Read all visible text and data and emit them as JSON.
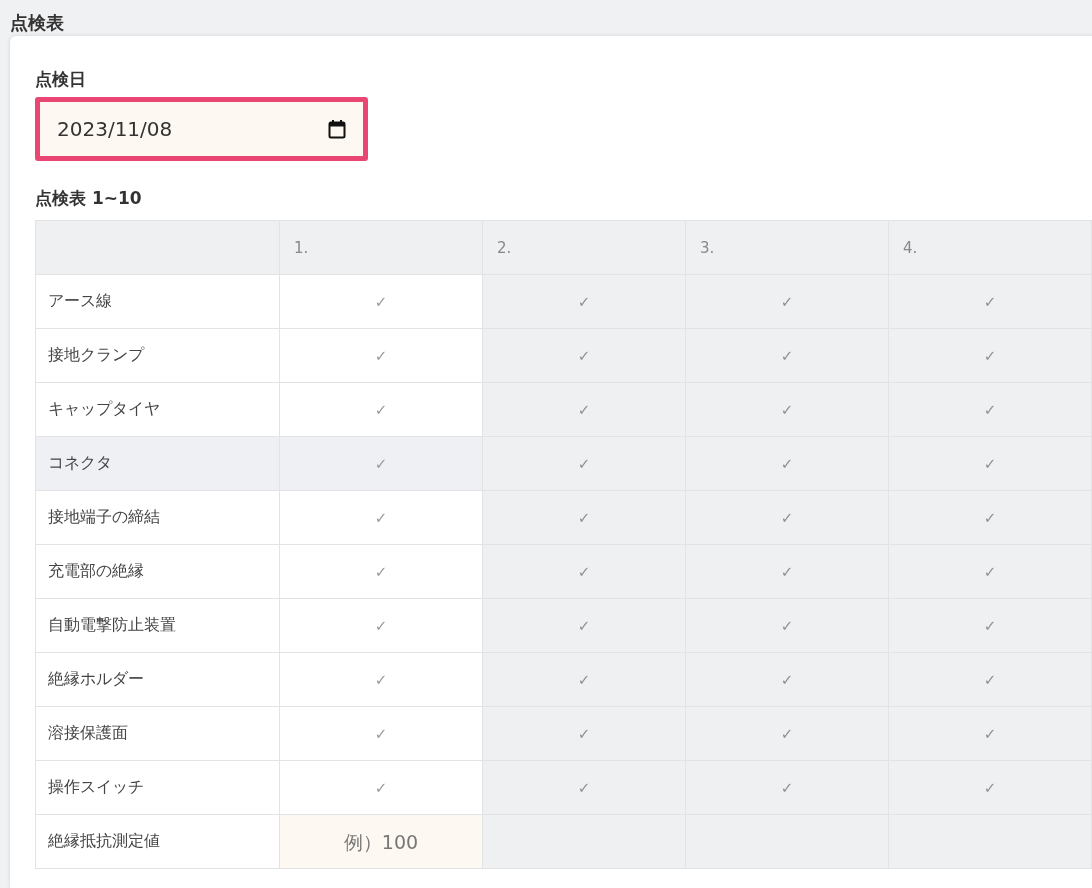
{
  "page_title": "点検表",
  "date": {
    "label": "点検日",
    "value": "2023/11/08",
    "focused": true
  },
  "table": {
    "title": "点検表 1~10",
    "columns": [
      {
        "label": "1.",
        "disabled": false
      },
      {
        "label": "2.",
        "disabled": true
      },
      {
        "label": "3.",
        "disabled": true
      },
      {
        "label": "4.",
        "disabled": true
      }
    ],
    "rows": [
      {
        "kind": "check",
        "label": "アース線",
        "hovered": false,
        "cells": [
          "✓",
          "✓",
          "✓",
          "✓"
        ]
      },
      {
        "kind": "check",
        "label": "接地クランプ",
        "hovered": false,
        "cells": [
          "✓",
          "✓",
          "✓",
          "✓"
        ]
      },
      {
        "kind": "check",
        "label": "キャップタイヤ",
        "hovered": false,
        "cells": [
          "✓",
          "✓",
          "✓",
          "✓"
        ]
      },
      {
        "kind": "check",
        "label": "コネクタ",
        "hovered": true,
        "cells": [
          "✓",
          "✓",
          "✓",
          "✓"
        ]
      },
      {
        "kind": "check",
        "label": "接地端子の締結",
        "hovered": false,
        "cells": [
          "✓",
          "✓",
          "✓",
          "✓"
        ]
      },
      {
        "kind": "check",
        "label": "充電部の絶縁",
        "hovered": false,
        "cells": [
          "✓",
          "✓",
          "✓",
          "✓"
        ]
      },
      {
        "kind": "check",
        "label": "自動電撃防止装置",
        "hovered": false,
        "cells": [
          "✓",
          "✓",
          "✓",
          "✓"
        ]
      },
      {
        "kind": "check",
        "label": "絶縁ホルダー",
        "hovered": false,
        "cells": [
          "✓",
          "✓",
          "✓",
          "✓"
        ]
      },
      {
        "kind": "check",
        "label": "溶接保護面",
        "hovered": false,
        "cells": [
          "✓",
          "✓",
          "✓",
          "✓"
        ]
      },
      {
        "kind": "check",
        "label": "操作スイッチ",
        "hovered": false,
        "cells": [
          "✓",
          "✓",
          "✓",
          "✓"
        ]
      },
      {
        "kind": "input",
        "label": "絶縁抵抗測定値",
        "hovered": false,
        "placeholder": "例）100"
      }
    ]
  }
}
